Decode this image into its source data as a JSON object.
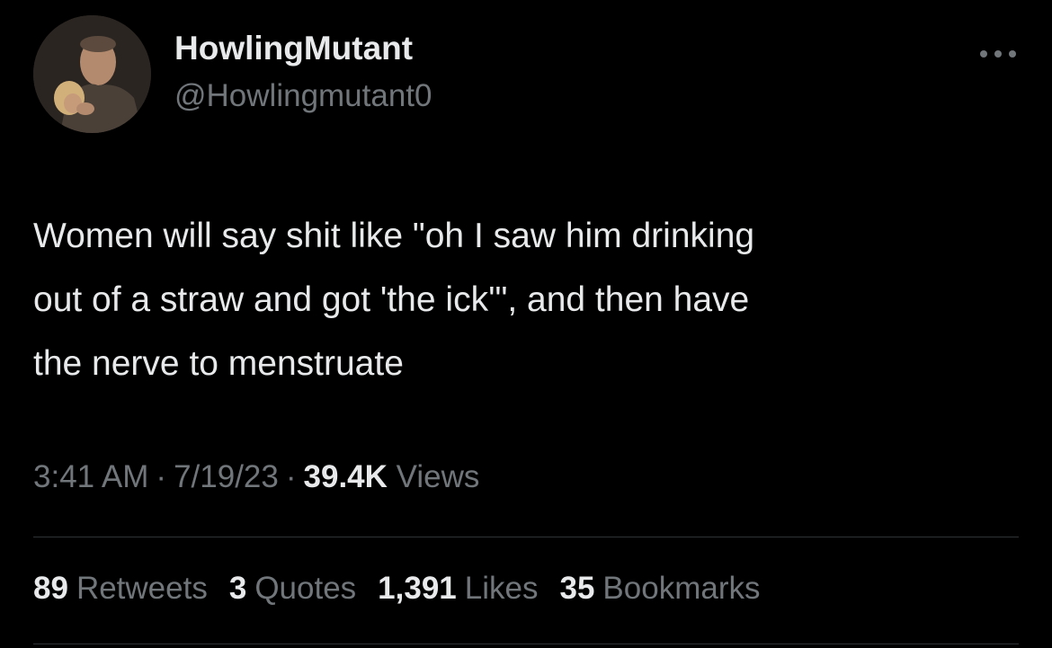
{
  "user": {
    "display_name": "HowlingMutant",
    "handle": "@Howlingmutant0",
    "avatar_icon": "profile-photo"
  },
  "more_icon": "more-horizontal-icon",
  "tweet": {
    "text": "Women will say shit like \"oh I saw him drinking\nout of a straw and got 'the ick'\", and then have\nthe nerve to menstruate"
  },
  "meta": {
    "time": "3:41 AM",
    "separator": "·",
    "date": "7/19/23",
    "views_count": "39.4K",
    "views_label": "Views"
  },
  "stats": [
    {
      "count": "89",
      "label": "Retweets"
    },
    {
      "count": "3",
      "label": "Quotes"
    },
    {
      "count": "1,391",
      "label": "Likes"
    },
    {
      "count": "35",
      "label": "Bookmarks"
    }
  ],
  "colors": {
    "background": "#000000",
    "primary_text": "#e7e9ea",
    "secondary_text": "#71767b",
    "divider": "#2f3336"
  }
}
